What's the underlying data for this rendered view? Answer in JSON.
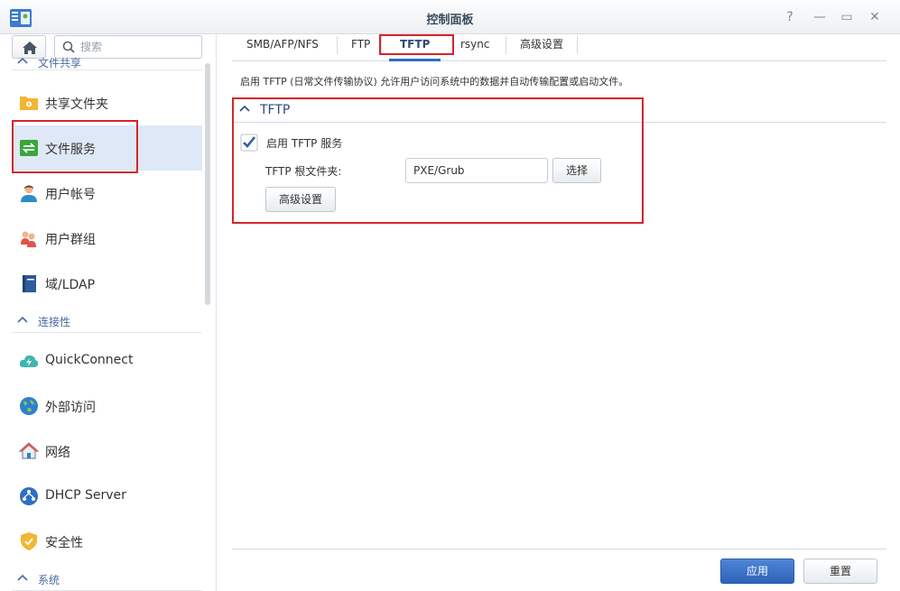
{
  "window": {
    "title": "控制面板",
    "help_icon": "help-icon",
    "minimize_icon": "minimize-icon",
    "maximize_icon": "maximize-icon",
    "close_icon": "close-icon"
  },
  "sidebar": {
    "search_placeholder": "搜索",
    "sections": [
      {
        "label": "文件共享"
      },
      {
        "label": "连接性"
      },
      {
        "label": "系统"
      }
    ],
    "items": [
      {
        "label": "共享文件夹",
        "icon": "shared-folder-icon"
      },
      {
        "label": "文件服务",
        "icon": "file-services-icon",
        "selected": true
      },
      {
        "label": "用户帐号",
        "icon": "user-icon"
      },
      {
        "label": "用户群组",
        "icon": "group-icon"
      },
      {
        "label": "域/LDAP",
        "icon": "domain-ldap-icon"
      },
      {
        "label": "QuickConnect",
        "icon": "quickconnect-icon"
      },
      {
        "label": "外部访问",
        "icon": "external-access-icon"
      },
      {
        "label": "网络",
        "icon": "network-icon"
      },
      {
        "label": "DHCP Server",
        "icon": "dhcp-server-icon"
      },
      {
        "label": "安全性",
        "icon": "security-icon"
      }
    ]
  },
  "tabs": [
    {
      "label": "SMB/AFP/NFS"
    },
    {
      "label": "FTP"
    },
    {
      "label": "TFTP",
      "active": true
    },
    {
      "label": "rsync"
    },
    {
      "label": "高级设置"
    }
  ],
  "main": {
    "description": "启用 TFTP (日常文件传输协议) 允许用户访问系统中的数据并自动传输配置或启动文件。",
    "panel_title": "TFTP",
    "enable_label": "启用 TFTP 服务",
    "enable_checked": true,
    "root_folder_label": "TFTP 根文件夹:",
    "root_folder_value": "PXE/Grub",
    "select_button": "选择",
    "advanced_button": "高级设置"
  },
  "footer": {
    "apply_button": "应用",
    "reset_button": "重置"
  },
  "colors": {
    "accent": "#2c6cc7",
    "highlight_box": "#d6252a",
    "selected_row": "#dfe8f6"
  }
}
